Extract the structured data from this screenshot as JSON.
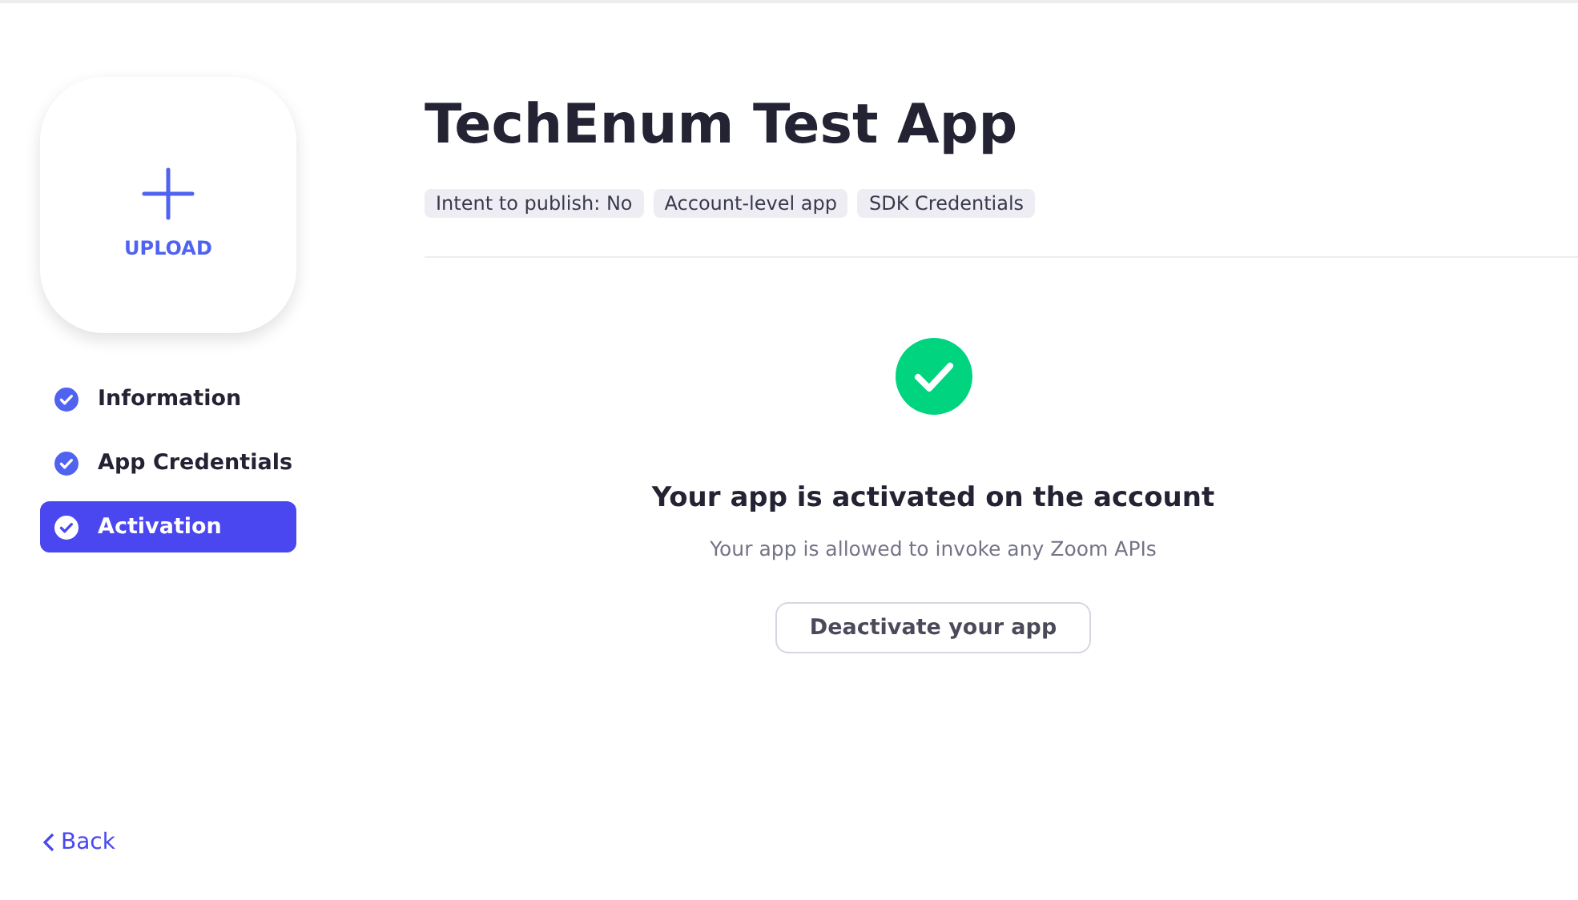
{
  "upload": {
    "label": "UPLOAD"
  },
  "steps": [
    {
      "label": "Information",
      "selected": false
    },
    {
      "label": "App Credentials",
      "selected": false
    },
    {
      "label": "Activation",
      "selected": true
    }
  ],
  "back": {
    "label": "Back"
  },
  "app": {
    "title": "TechEnum Test App",
    "tags": [
      "Intent to publish: No",
      "Account-level app",
      "SDK Credentials"
    ]
  },
  "status": {
    "heading": "Your app is activated on the account",
    "description": "Your app is allowed to invoke any Zoom APIs",
    "button": "Deactivate your app"
  }
}
